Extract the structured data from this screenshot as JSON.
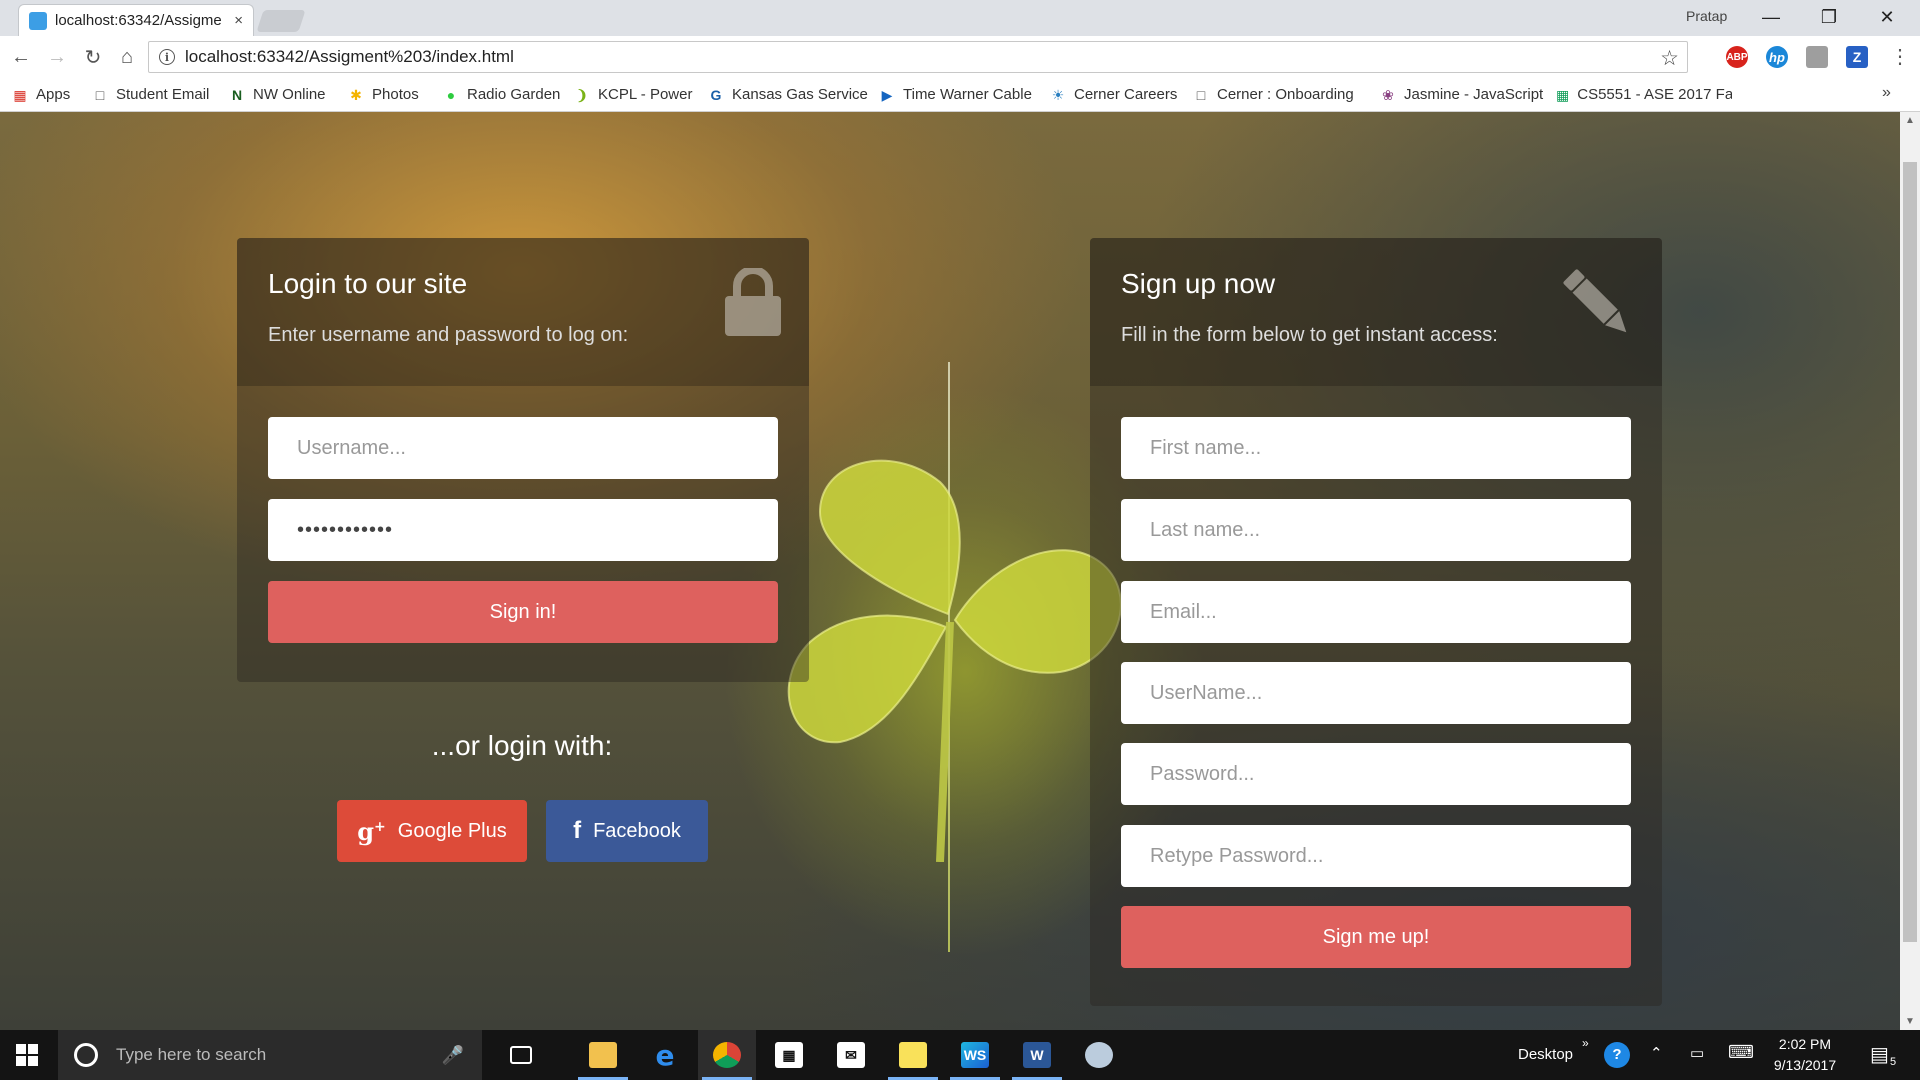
{
  "browser": {
    "tab_title": "localhost:63342/Assigme",
    "tab_close": "×",
    "user": "Pratap",
    "url": "localhost:63342/Assigment%203/index.html",
    "bookmarks": [
      {
        "label": "Apps",
        "icon": "apps-grid-icon",
        "color": "#d93025"
      },
      {
        "label": "Student Email",
        "icon": "page-icon",
        "color": "#555555"
      },
      {
        "label": "NW Online",
        "icon": "nw-icon",
        "color": "#1a5e20"
      },
      {
        "label": "Photos",
        "icon": "photos-icon",
        "color": "#f4b400"
      },
      {
        "label": "Radio Garden",
        "icon": "radio-garden-icon",
        "color": "#2ecc40"
      },
      {
        "label": "KCPL - Power",
        "icon": "kcpl-icon",
        "color": "#7ab317"
      },
      {
        "label": "Kansas Gas Service",
        "icon": "gas-service-icon",
        "color": "#1a5fa8"
      },
      {
        "label": "Time Warner Cable",
        "icon": "twc-icon",
        "color": "#1565c0"
      },
      {
        "label": "Cerner Careers",
        "icon": "cerner-icon",
        "color": "#2a7fc0"
      },
      {
        "label": "Cerner : Onboarding",
        "icon": "page-icon",
        "color": "#555555"
      },
      {
        "label": "Jasmine - JavaScript",
        "icon": "jasmine-icon",
        "color": "#8a4182"
      },
      {
        "label": "CS5551 - ASE 2017 Fa",
        "icon": "sheets-icon",
        "color": "#0f9d58"
      }
    ]
  },
  "login": {
    "title": "Login to our site",
    "description": "Enter username and password to log on:",
    "username_placeholder": "Username...",
    "password_value": "••••••••••••",
    "submit_label": "Sign in!",
    "social_title": "...or login with:",
    "google_label": "Google Plus",
    "facebook_label": "Facebook",
    "google_color": "#dd4b39",
    "facebook_color": "#3b5998"
  },
  "signup": {
    "title": "Sign up now",
    "description": "Fill in the form below to get instant access:",
    "first_name_placeholder": "First name...",
    "last_name_placeholder": "Last name...",
    "email_placeholder": "Email...",
    "username_placeholder": "UserName...",
    "password_placeholder": "Password...",
    "retype_password_placeholder": "Retype Password...",
    "submit_label": "Sign me up!",
    "button_color": "#de615e"
  },
  "taskbar": {
    "search_placeholder": "Type here to search",
    "desktop_label": "Desktop",
    "time": "2:02 PM",
    "date": "9/13/2017",
    "notification_count": "5"
  }
}
